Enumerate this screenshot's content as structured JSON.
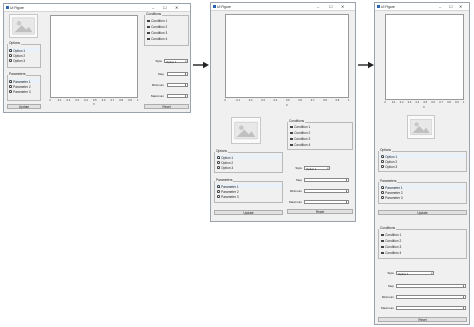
{
  "window": {
    "title": "UI Figure",
    "ctl_min": "–",
    "ctl_max": "☐",
    "ctl_close": "✕"
  },
  "options": {
    "title": "Options",
    "items": [
      "Option 1",
      "Option 2",
      "Option 3"
    ],
    "selected": 0
  },
  "parameters": {
    "title": "Parameters",
    "items": [
      "Parameter 1",
      "Parameter 2",
      "Parameter 3"
    ],
    "selected": 0
  },
  "update_label": "Update",
  "conditions": {
    "title": "Conditions",
    "items": [
      "Condition 1",
      "Condition 2",
      "Condition 3",
      "Condition 4"
    ]
  },
  "style": {
    "label": "Style",
    "value": "Option 1"
  },
  "step_label": "Step",
  "minimum_label": "Minimum",
  "maximum_label": "Maximum",
  "reset_label": "Reset",
  "axes": {
    "xlabel": "X",
    "xticks": [
      "0",
      "0.1",
      "0.2",
      "0.3",
      "0.4",
      "0.5",
      "0.6",
      "0.7",
      "0.8",
      "0.9",
      "1"
    ]
  },
  "colors": {
    "selection": "#e9f1fb",
    "arrow": "#222222",
    "title_icon": "#2a66b0"
  },
  "icons": {
    "image_placeholder": "image-icon",
    "flow_arrow": "arrow-right-icon"
  }
}
